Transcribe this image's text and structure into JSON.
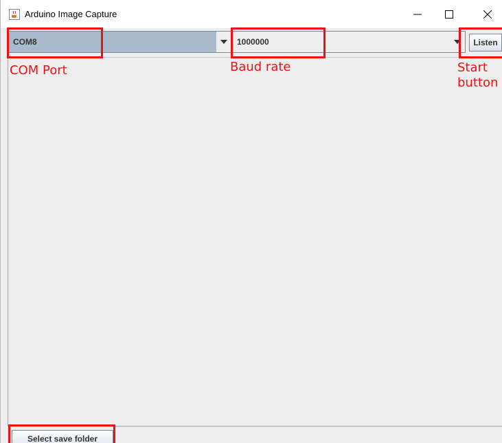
{
  "window": {
    "title": "Arduino Image Capture"
  },
  "toolbar": {
    "com_port_value": "COM8",
    "baud_rate_value": "1000000",
    "listen_label": "Listen"
  },
  "footer": {
    "save_folder_label": "Select save folder"
  },
  "annotations": {
    "com_port": "COM Port",
    "baud_rate": "Baud rate",
    "start_button_line1": "Start",
    "start_button_line2": "button"
  },
  "colors": {
    "annotation": "#ee1111",
    "combo_selected": "#a8bacb",
    "window_bg": "#eeeeee"
  },
  "icons": {
    "app": "java-coffee-icon",
    "minimize": "minimize-icon",
    "maximize": "maximize-icon",
    "close": "close-icon",
    "dropdown": "chevron-down-icon"
  }
}
